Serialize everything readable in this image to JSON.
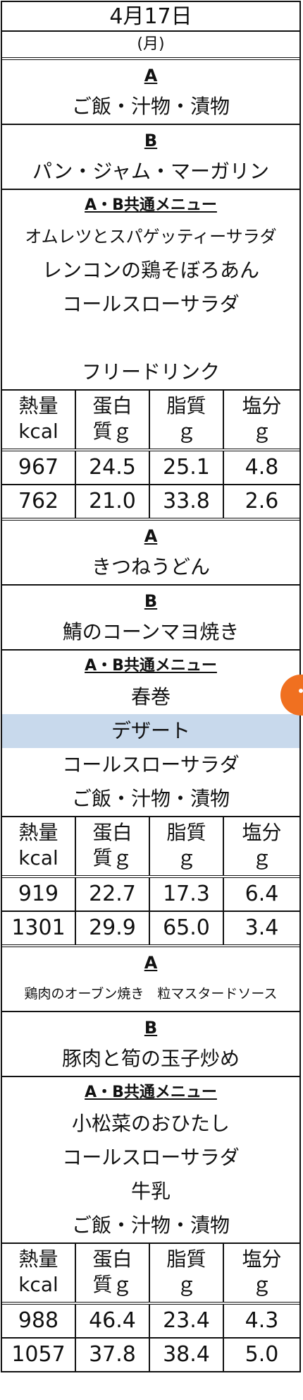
{
  "header": {
    "date": "4月17日",
    "dow": "(月)"
  },
  "meal1": {
    "a_label": "A",
    "a_items": [
      "ご飯・汁物・漬物"
    ],
    "b_label": "B",
    "b_items": [
      "パン・ジャム・マーガリン"
    ],
    "common_label": "A・B共通メニュー",
    "common_items": [
      "オムレツとスパゲッティーサラダ",
      "レンコンの鶏そぼろあん",
      "コールスローサラダ",
      "",
      "フリードリンク"
    ],
    "nutrition_headers": [
      "熱量\nkcal",
      "蛋白\n質ｇ",
      "脂質\nｇ",
      "塩分\nｇ"
    ],
    "rows": [
      [
        "967",
        "24.5",
        "25.1",
        "4.8"
      ],
      [
        "762",
        "21.0",
        "33.8",
        "2.6"
      ]
    ]
  },
  "meal2": {
    "a_label": "A",
    "a_items": [
      "きつねうどん"
    ],
    "b_label": "B",
    "b_items": [
      "鯖のコーンマヨ焼き"
    ],
    "common_label": "A・B共通メニュー",
    "common_items": [
      "春巻",
      "デザート",
      "コールスローサラダ",
      "ご飯・汁物・漬物"
    ],
    "nutrition_headers": [
      "熱量\nkcal",
      "蛋白\n質ｇ",
      "脂質\nｇ",
      "塩分\nｇ"
    ],
    "rows": [
      [
        "919",
        "22.7",
        "17.3",
        "6.4"
      ],
      [
        "1301",
        "29.9",
        "65.0",
        "3.4"
      ]
    ]
  },
  "meal3": {
    "a_label": "A",
    "a_items": [
      "鶏肉のオーブン焼き　粒マスタードソース"
    ],
    "b_label": "B",
    "b_items": [
      "豚肉と筍の玉子炒め"
    ],
    "common_label": "A・B共通メニュー",
    "common_items": [
      "小松菜のおひたし",
      "コールスローサラダ",
      "牛乳",
      "ご飯・汁物・漬物"
    ],
    "nutrition_headers": [
      "熱量\nkcal",
      "蛋白\n質ｇ",
      "脂質\nｇ",
      "塩分\nｇ"
    ],
    "rows": [
      [
        "988",
        "46.4",
        "23.4",
        "4.3"
      ],
      [
        "1057",
        "37.8",
        "38.4",
        "5.0"
      ]
    ]
  },
  "colors": {
    "highlight": "#c8d9ec",
    "bubble": "#f07020"
  }
}
